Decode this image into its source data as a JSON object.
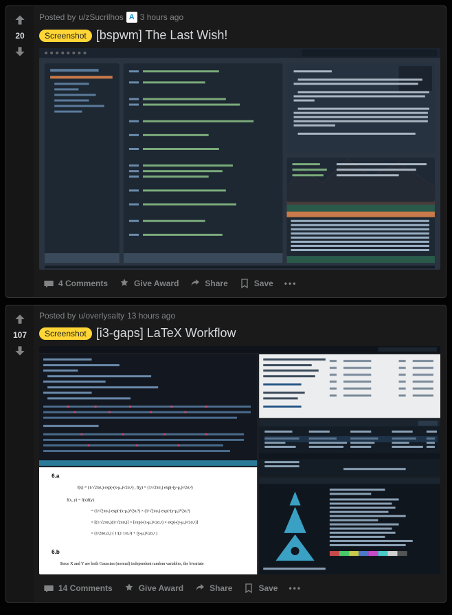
{
  "posts": [
    {
      "meta": {
        "prefix": "Posted by",
        "author": "u/zSucrilhos",
        "avatar_glyph": "A",
        "time": "3 hours ago"
      },
      "score": "20",
      "flair": "Screenshot",
      "title": "[bspwm] The Last Wish!",
      "actions": {
        "comments": "4 Comments",
        "award": "Give Award",
        "share": "Share",
        "save": "Save"
      }
    },
    {
      "meta": {
        "prefix": "Posted by",
        "author": "u/overlysalty",
        "time": "13 hours ago"
      },
      "score": "107",
      "flair": "Screenshot",
      "title": "[i3-gaps] LaTeX Workflow",
      "actions": {
        "comments": "14 Comments",
        "award": "Give Award",
        "share": "Share",
        "save": "Save"
      }
    }
  ]
}
